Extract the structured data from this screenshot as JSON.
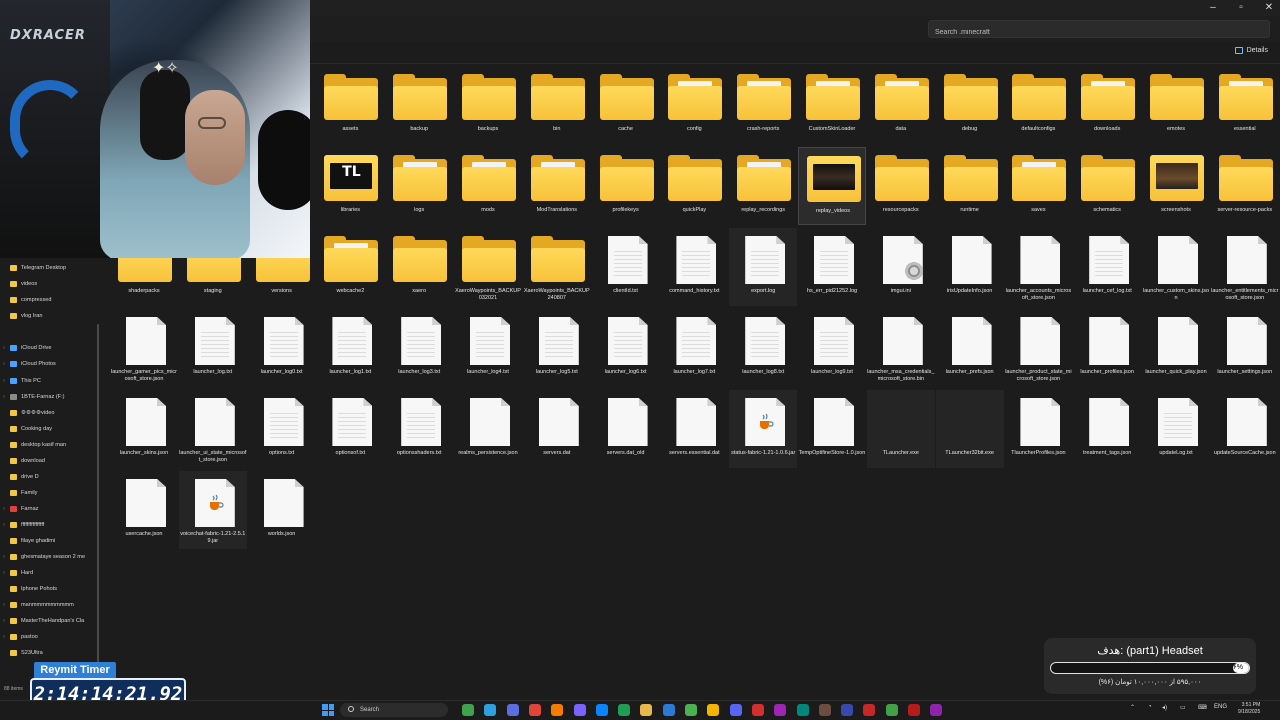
{
  "search": {
    "placeholder": "Search .minecraft"
  },
  "toolbar": {
    "details_label": "Details"
  },
  "sidebar": {
    "items": [
      {
        "label": "Telegram Desktop",
        "color": "#f2c744"
      },
      {
        "label": "videos",
        "color": "#f2c744"
      },
      {
        "label": "compressed",
        "color": "#f2c744"
      },
      {
        "label": "vlog Iran",
        "color": "#f2c744"
      },
      {
        "label": "iCloud Drive",
        "color": "#4aa3ff"
      },
      {
        "label": "iCloud Photos",
        "color": "#4aa3ff"
      },
      {
        "label": "This PC",
        "color": "#4aa3ff"
      },
      {
        "label": "1BTE-Farnaz (F:)",
        "color": "#8a8a8a"
      },
      {
        "label": "⚙⚙⚙⚙video",
        "color": "#f2c744"
      },
      {
        "label": "Cooking day",
        "color": "#f2c744"
      },
      {
        "label": "desktop kasif man",
        "color": "#f2c744"
      },
      {
        "label": "download",
        "color": "#f2c744"
      },
      {
        "label": "drive D",
        "color": "#f2c744"
      },
      {
        "label": "Family",
        "color": "#f2c744"
      },
      {
        "label": "Farnaz",
        "color": "#e04040"
      },
      {
        "label": "ffffffffffffffff",
        "color": "#f2c744"
      },
      {
        "label": "filaye ghadimi",
        "color": "#f2c744"
      },
      {
        "label": "ghesmataye season 2 me",
        "color": "#f2c744"
      },
      {
        "label": "Hard",
        "color": "#f2c744"
      },
      {
        "label": "Iphone Pohots",
        "color": "#f2c744"
      },
      {
        "label": "manmmmmmmmmm",
        "color": "#f2c744"
      },
      {
        "label": "MasterTheHandpan's Cla",
        "color": "#f2c744"
      },
      {
        "label": "pastoo",
        "color": "#f2c744"
      },
      {
        "label": "S23Ultra",
        "color": "#f2c744"
      }
    ],
    "items_count": "88 items"
  },
  "files": [
    {
      "label": "assets",
      "kind": "folder"
    },
    {
      "label": "backup",
      "kind": "folder"
    },
    {
      "label": "backups",
      "kind": "folder"
    },
    {
      "label": "bin",
      "kind": "folder"
    },
    {
      "label": "cache",
      "kind": "folder"
    },
    {
      "label": "config",
      "kind": "folder-docs"
    },
    {
      "label": "crash-reports",
      "kind": "folder-docs"
    },
    {
      "label": "CustomSkinLoader",
      "kind": "folder-docs"
    },
    {
      "label": "data",
      "kind": "folder-docs"
    },
    {
      "label": "debug",
      "kind": "folder"
    },
    {
      "label": "defaultconfigs",
      "kind": "folder"
    },
    {
      "label": "downloads",
      "kind": "folder-docs"
    },
    {
      "label": "emotes",
      "kind": "folder"
    },
    {
      "label": "essential",
      "kind": "folder-docs"
    },
    {
      "label": "libraries",
      "kind": "folder-tl",
      "thumb_text": "TL"
    },
    {
      "label": "logs",
      "kind": "folder-docs"
    },
    {
      "label": "mods",
      "kind": "folder-docs"
    },
    {
      "label": "ModTranslations",
      "kind": "folder-docs"
    },
    {
      "label": "profilekeys",
      "kind": "folder"
    },
    {
      "label": "quickPlay",
      "kind": "folder"
    },
    {
      "label": "replay_recordings",
      "kind": "folder-docs"
    },
    {
      "label": "replay_videos",
      "kind": "folder-video"
    },
    {
      "label": "resourcepacks",
      "kind": "folder"
    },
    {
      "label": "runtime",
      "kind": "folder"
    },
    {
      "label": "saves",
      "kind": "folder-docs"
    },
    {
      "label": "schematics",
      "kind": "folder"
    },
    {
      "label": "screenshots",
      "kind": "folder-mc"
    },
    {
      "label": "server-resource-packs",
      "kind": "folder"
    },
    {
      "label": "shaderpacks",
      "kind": "folder"
    },
    {
      "label": "staging",
      "kind": "folder"
    },
    {
      "label": "versions",
      "kind": "folder"
    },
    {
      "label": "webcache2",
      "kind": "folder-docs"
    },
    {
      "label": "xaero",
      "kind": "folder"
    },
    {
      "label": "XaeroWaypoints_BACKUP032021",
      "kind": "folder"
    },
    {
      "label": "XaeroWaypoints_BACKUP240807",
      "kind": "folder"
    },
    {
      "label": "clientId.txt",
      "kind": "text"
    },
    {
      "label": "command_history.txt",
      "kind": "text"
    },
    {
      "label": "export.log",
      "kind": "text"
    },
    {
      "label": "hs_err_pid21252.log",
      "kind": "text"
    },
    {
      "label": "imgui.ini",
      "kind": "ini"
    },
    {
      "label": "irisUpdateInfo.json",
      "kind": "file"
    },
    {
      "label": "launcher_accounts_microsoft_store.json",
      "kind": "file"
    },
    {
      "label": "launcher_cef_log.txt",
      "kind": "text"
    },
    {
      "label": "launcher_custom_skins.json",
      "kind": "file"
    },
    {
      "label": "launcher_entitlements_microsoft_store.json",
      "kind": "file"
    },
    {
      "label": "launcher_gamer_pics_microsoft_store.json",
      "kind": "file"
    },
    {
      "label": "launcher_log.txt",
      "kind": "text"
    },
    {
      "label": "launcher_log0.txt",
      "kind": "text"
    },
    {
      "label": "launcher_log1.txt",
      "kind": "text"
    },
    {
      "label": "launcher_log3.txt",
      "kind": "text"
    },
    {
      "label": "launcher_log4.txt",
      "kind": "text"
    },
    {
      "label": "launcher_log5.txt",
      "kind": "text"
    },
    {
      "label": "launcher_log6.txt",
      "kind": "text"
    },
    {
      "label": "launcher_log7.txt",
      "kind": "text"
    },
    {
      "label": "launcher_log8.txt",
      "kind": "text"
    },
    {
      "label": "launcher_log9.txt",
      "kind": "text"
    },
    {
      "label": "launcher_msa_credentials_microsoft_store.bin",
      "kind": "file"
    },
    {
      "label": "launcher_prefs.json",
      "kind": "file"
    },
    {
      "label": "launcher_product_state_microsoft_store.json",
      "kind": "file"
    },
    {
      "label": "launcher_profiles.json",
      "kind": "file"
    },
    {
      "label": "launcher_quick_play.json",
      "kind": "file"
    },
    {
      "label": "launcher_settings.json",
      "kind": "file"
    },
    {
      "label": "launcher_skins.json",
      "kind": "file"
    },
    {
      "label": "launcher_ui_state_microsoft_store.json",
      "kind": "file"
    },
    {
      "label": "options.txt",
      "kind": "text"
    },
    {
      "label": "optionsof.txt",
      "kind": "text"
    },
    {
      "label": "optionsshaders.txt",
      "kind": "text"
    },
    {
      "label": "realms_persistence.json",
      "kind": "file"
    },
    {
      "label": "servers.dat",
      "kind": "file"
    },
    {
      "label": "servers.dat_old",
      "kind": "file"
    },
    {
      "label": "servers.essential.dat",
      "kind": "file"
    },
    {
      "label": "status-fabric-1.21-1.0.6.jar",
      "kind": "jar"
    },
    {
      "label": "TempOptifineStore-1.0.json",
      "kind": "file"
    },
    {
      "label": "TLauncher.exe",
      "kind": "exe"
    },
    {
      "label": "TLauncher32bit.exe",
      "kind": "exe"
    },
    {
      "label": "TlauncherProfiles.json",
      "kind": "file"
    },
    {
      "label": "treatment_tags.json",
      "kind": "file"
    },
    {
      "label": "updateLog.txt",
      "kind": "text"
    },
    {
      "label": "updateSourceCache.json",
      "kind": "file"
    },
    {
      "label": "usercache.json",
      "kind": "file"
    },
    {
      "label": "voicechat-fabric-1.21-2.5.19.jar",
      "kind": "jar"
    },
    {
      "label": "worlds.json",
      "kind": "file"
    }
  ],
  "webcam": {
    "brand": "DXRACER"
  },
  "timer": {
    "title": "Reymit Timer",
    "value": "2:14:14:21.92"
  },
  "goal": {
    "title": "هدف: (part1) Headset",
    "percent_label": "۶%",
    "progress_fraction": 0.06,
    "subtitle": "۵۹۵,۰۰۰ از ۱۰,۰۰۰,۰۰۰ تومان (۶%)"
  },
  "taskbar": {
    "search_label": "Search",
    "lang": "ENG",
    "time": "3:51 PM",
    "date": "9/18/2025",
    "app_colors": [
      "#3fa34d",
      "#2ea0e0",
      "#5b6ee1",
      "#e0453a",
      "#f57c00",
      "#7b61ff",
      "#0a84ff",
      "#1f9d55",
      "#e8b84a",
      "#2a7bd6",
      "#4caf50",
      "#f4b400",
      "#5865f2",
      "#d32f2f",
      "#9c27b0",
      "#00897b",
      "#6d4c41",
      "#3949ab",
      "#c62828",
      "#43a047",
      "#b71c1c",
      "#8e24aa"
    ]
  }
}
